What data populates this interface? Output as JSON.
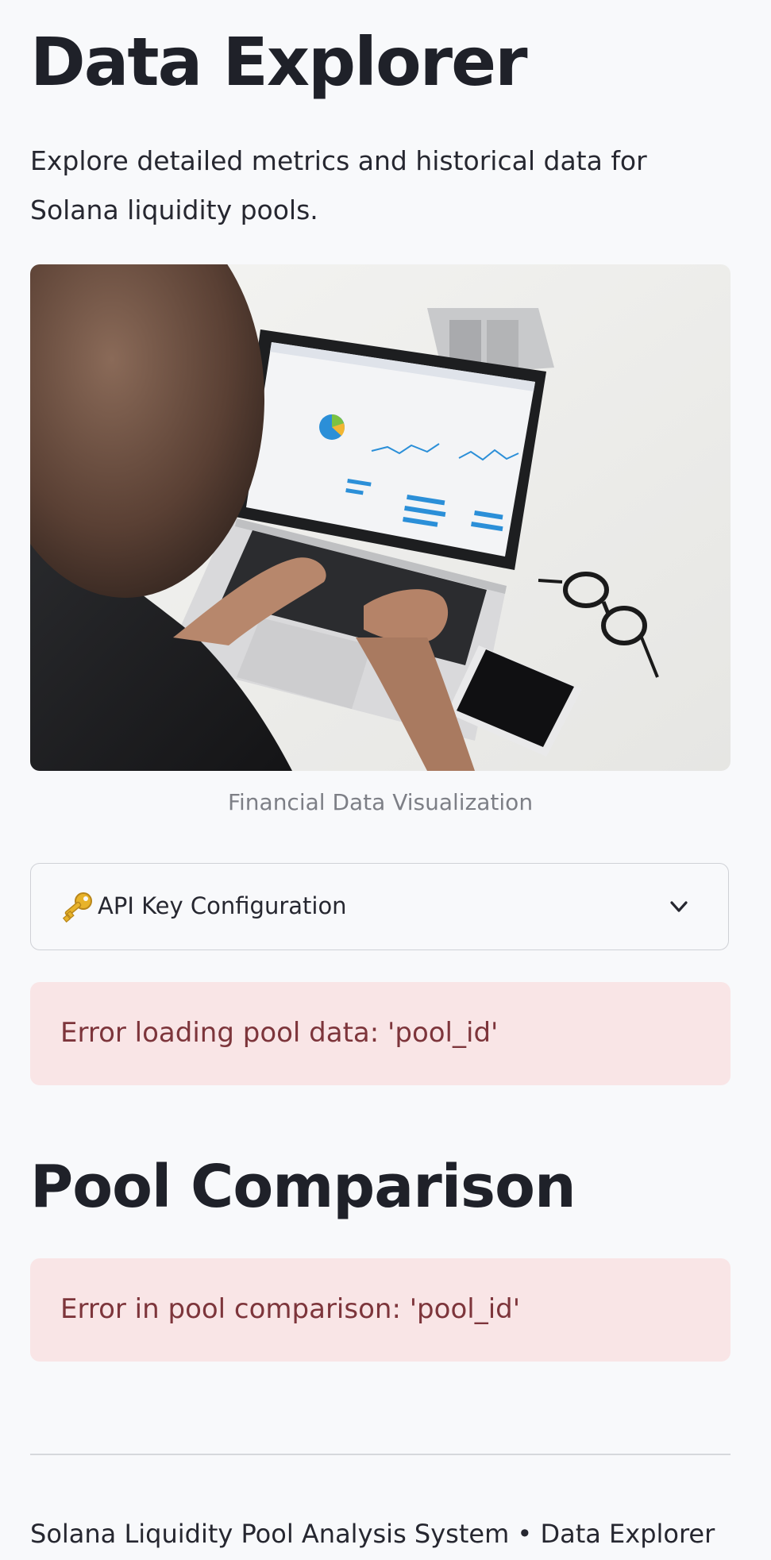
{
  "header": {
    "title": "Data Explorer",
    "subtitle": "Explore detailed metrics and historical data for Solana liquidity pools."
  },
  "hero": {
    "caption": "Financial Data Visualization",
    "alt": "Person typing on a laptop showing financial dashboards"
  },
  "api_config": {
    "icon": "key-icon",
    "label": "API Key Configuration",
    "expanded": false
  },
  "errors": {
    "pool_data": "Error loading pool data: 'pool_id'",
    "pool_comparison": "Error in pool comparison: 'pool_id'"
  },
  "comparison": {
    "title": "Pool Comparison"
  },
  "footer": {
    "text": "Solana Liquidity Pool Analysis System • Data Explorer"
  },
  "colors": {
    "background": "#f8f9fb",
    "error_bg": "#f9e5e6",
    "error_text": "#7d353b",
    "text": "#262730"
  }
}
